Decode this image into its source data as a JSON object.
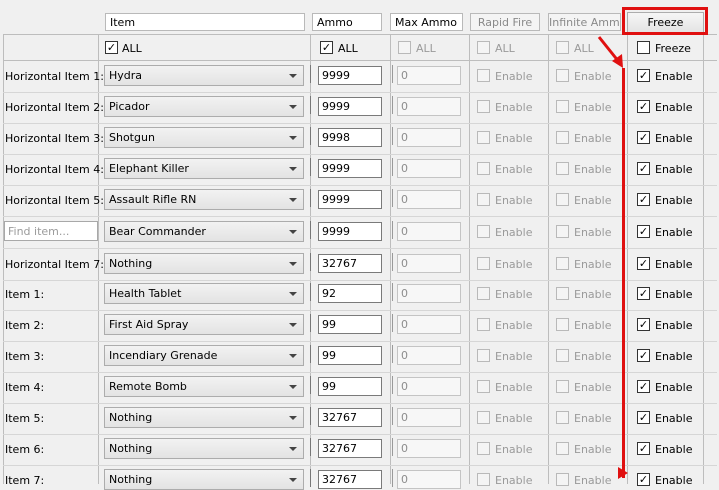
{
  "headers": {
    "item": "Item",
    "ammo": "Ammo",
    "max_ammo": "Max Ammo",
    "rapid_fire": "Rapid Fire",
    "infinite_ammo": "Infinite Ammo",
    "freeze": "Freeze"
  },
  "all_row": {
    "item_all": "ALL",
    "ammo_all": "ALL",
    "max_all": "ALL",
    "rapid_all": "ALL",
    "infinite_all": "ALL",
    "freeze_all": "Freeze",
    "item_checked": "✓",
    "ammo_checked": "✓"
  },
  "find_placeholder": "Find item...",
  "enable_label": "Enable",
  "check_mark": "✓",
  "rows": [
    {
      "label": "Horizontal Item 1:",
      "item": "Hydra",
      "ammo": "9999",
      "max": "0"
    },
    {
      "label": "Horizontal Item 2:",
      "item": "Picador",
      "ammo": "9999",
      "max": "0"
    },
    {
      "label": "Horizontal Item 3:",
      "item": "Shotgun",
      "ammo": "9998",
      "max": "0"
    },
    {
      "label": "Horizontal Item 4:",
      "item": "Elephant Killer",
      "ammo": "9999",
      "max": "0"
    },
    {
      "label": "Horizontal Item 5:",
      "item": "Assault Rifle RN",
      "ammo": "9999",
      "max": "0"
    },
    {
      "label": "",
      "item": "Bear Commander",
      "ammo": "9999",
      "max": "0"
    },
    {
      "label": "Horizontal Item 7:",
      "item": "Nothing",
      "ammo": "32767",
      "max": "0"
    },
    {
      "label": "Item 1:",
      "item": "Health Tablet",
      "ammo": "92",
      "max": "0"
    },
    {
      "label": "Item 2:",
      "item": "First Aid Spray",
      "ammo": "99",
      "max": "0"
    },
    {
      "label": "Item 3:",
      "item": "Incendiary Grenade",
      "ammo": "99",
      "max": "0"
    },
    {
      "label": "Item 4:",
      "item": "Remote Bomb",
      "ammo": "99",
      "max": "0"
    },
    {
      "label": "Item 5:",
      "item": "Nothing",
      "ammo": "32767",
      "max": "0"
    },
    {
      "label": "Item 6:",
      "item": "Nothing",
      "ammo": "32767",
      "max": "0"
    },
    {
      "label": "Item 7:",
      "item": "Nothing",
      "ammo": "32767",
      "max": "0"
    }
  ],
  "colors": {
    "annotation": "#e01010"
  }
}
